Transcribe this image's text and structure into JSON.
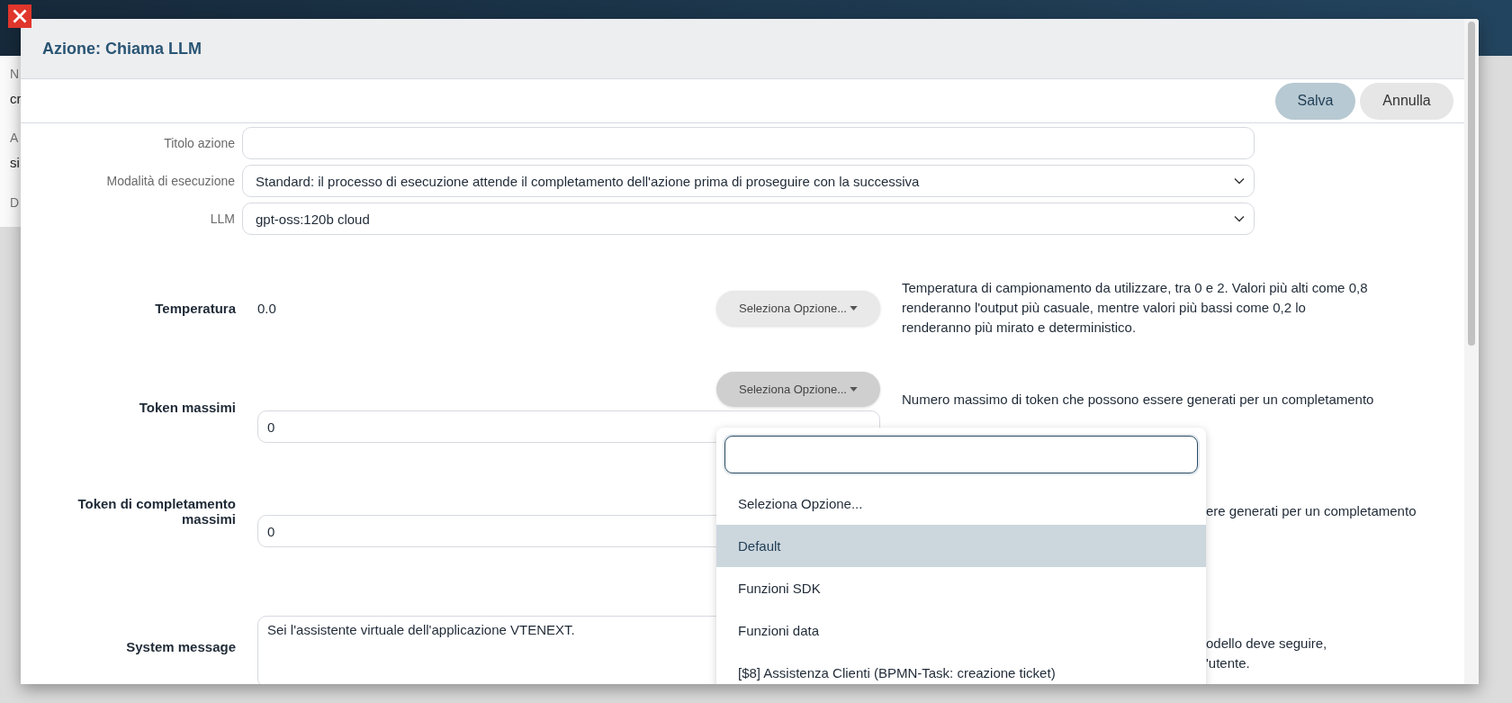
{
  "background": {
    "fragments": [
      "N",
      "cr",
      "A",
      "si",
      "D"
    ]
  },
  "dialog": {
    "title": "Azione: Chiama LLM",
    "buttons": [
      {
        "label": "Salva",
        "kind": "primary"
      },
      {
        "label": "Annulla",
        "kind": "secondary"
      }
    ],
    "fields": [
      {
        "label": "Titolo azione",
        "kind": "text"
      },
      {
        "label": "Modalità di esecuzione",
        "kind": "select",
        "value": "Standard: il processo di esecuzione attende il completamento dell'azione prima di proseguire con la successiva"
      },
      {
        "label": "LLM",
        "kind": "select",
        "value": "gpt-oss:120b cloud"
      }
    ],
    "parameters": [
      {
        "label": "Temperatura",
        "kind": "plain",
        "value": "0.0",
        "option_button": {
          "label": "Seleziona Opzione...",
          "pressed": false
        },
        "description": {
          "partial": false,
          "lines": [
            "Temperatura di campionamento da utilizzare, tra 0 e 2. Valori più alti come 0,8",
            "renderanno l'output più casuale, mentre valori più bassi come 0,2 lo",
            "renderanno più mirato e deterministico."
          ]
        }
      },
      {
        "label": "Token massimi",
        "kind": "input",
        "value": "0",
        "option_button": {
          "label": "Seleziona Opzione...",
          "pressed": true
        },
        "description": {
          "partial": false,
          "lines": [
            "Numero massimo di token che possono essere generati per un completamento"
          ]
        }
      },
      {
        "label": "Token di completamento massimi",
        "kind": "input",
        "value": "0",
        "description": {
          "partial": true,
          "lines": [
            "ere generati per un completamento"
          ]
        }
      },
      {
        "label": "System message",
        "kind": "textarea",
        "value": "Sei l'assistente virtuale dell'applicazione VTENEXT.",
        "description": {
          "partial": true,
          "lines": [
            "odello deve seguire,",
            "'utente."
          ]
        }
      }
    ],
    "dropdown": {
      "options": [
        {
          "label": "Seleziona Opzione...",
          "selected": false
        },
        {
          "label": "Default",
          "selected": true
        },
        {
          "label": "Funzioni SDK",
          "selected": false
        },
        {
          "label": "Funzioni data",
          "selected": false
        },
        {
          "label": "[$8] Assistenza Clienti (BPMN-Task: creazione ticket)",
          "selected": false
        }
      ]
    }
  }
}
